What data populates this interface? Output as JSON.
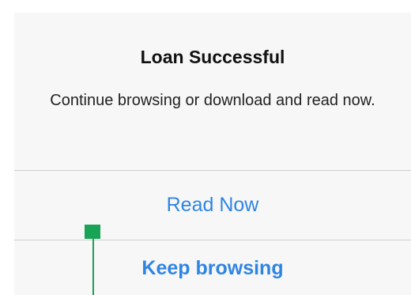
{
  "alert": {
    "title": "Loan Successful",
    "message": "Continue browsing or download and read now.",
    "actions": [
      {
        "label": "Read Now",
        "style": "default"
      },
      {
        "label": "Keep browsing",
        "style": "preferred"
      }
    ]
  },
  "colors": {
    "alert_background": "#f7f7f7",
    "action_text": "#2f85e3",
    "divider": "#cfcfcf",
    "marker": "#19a356"
  }
}
